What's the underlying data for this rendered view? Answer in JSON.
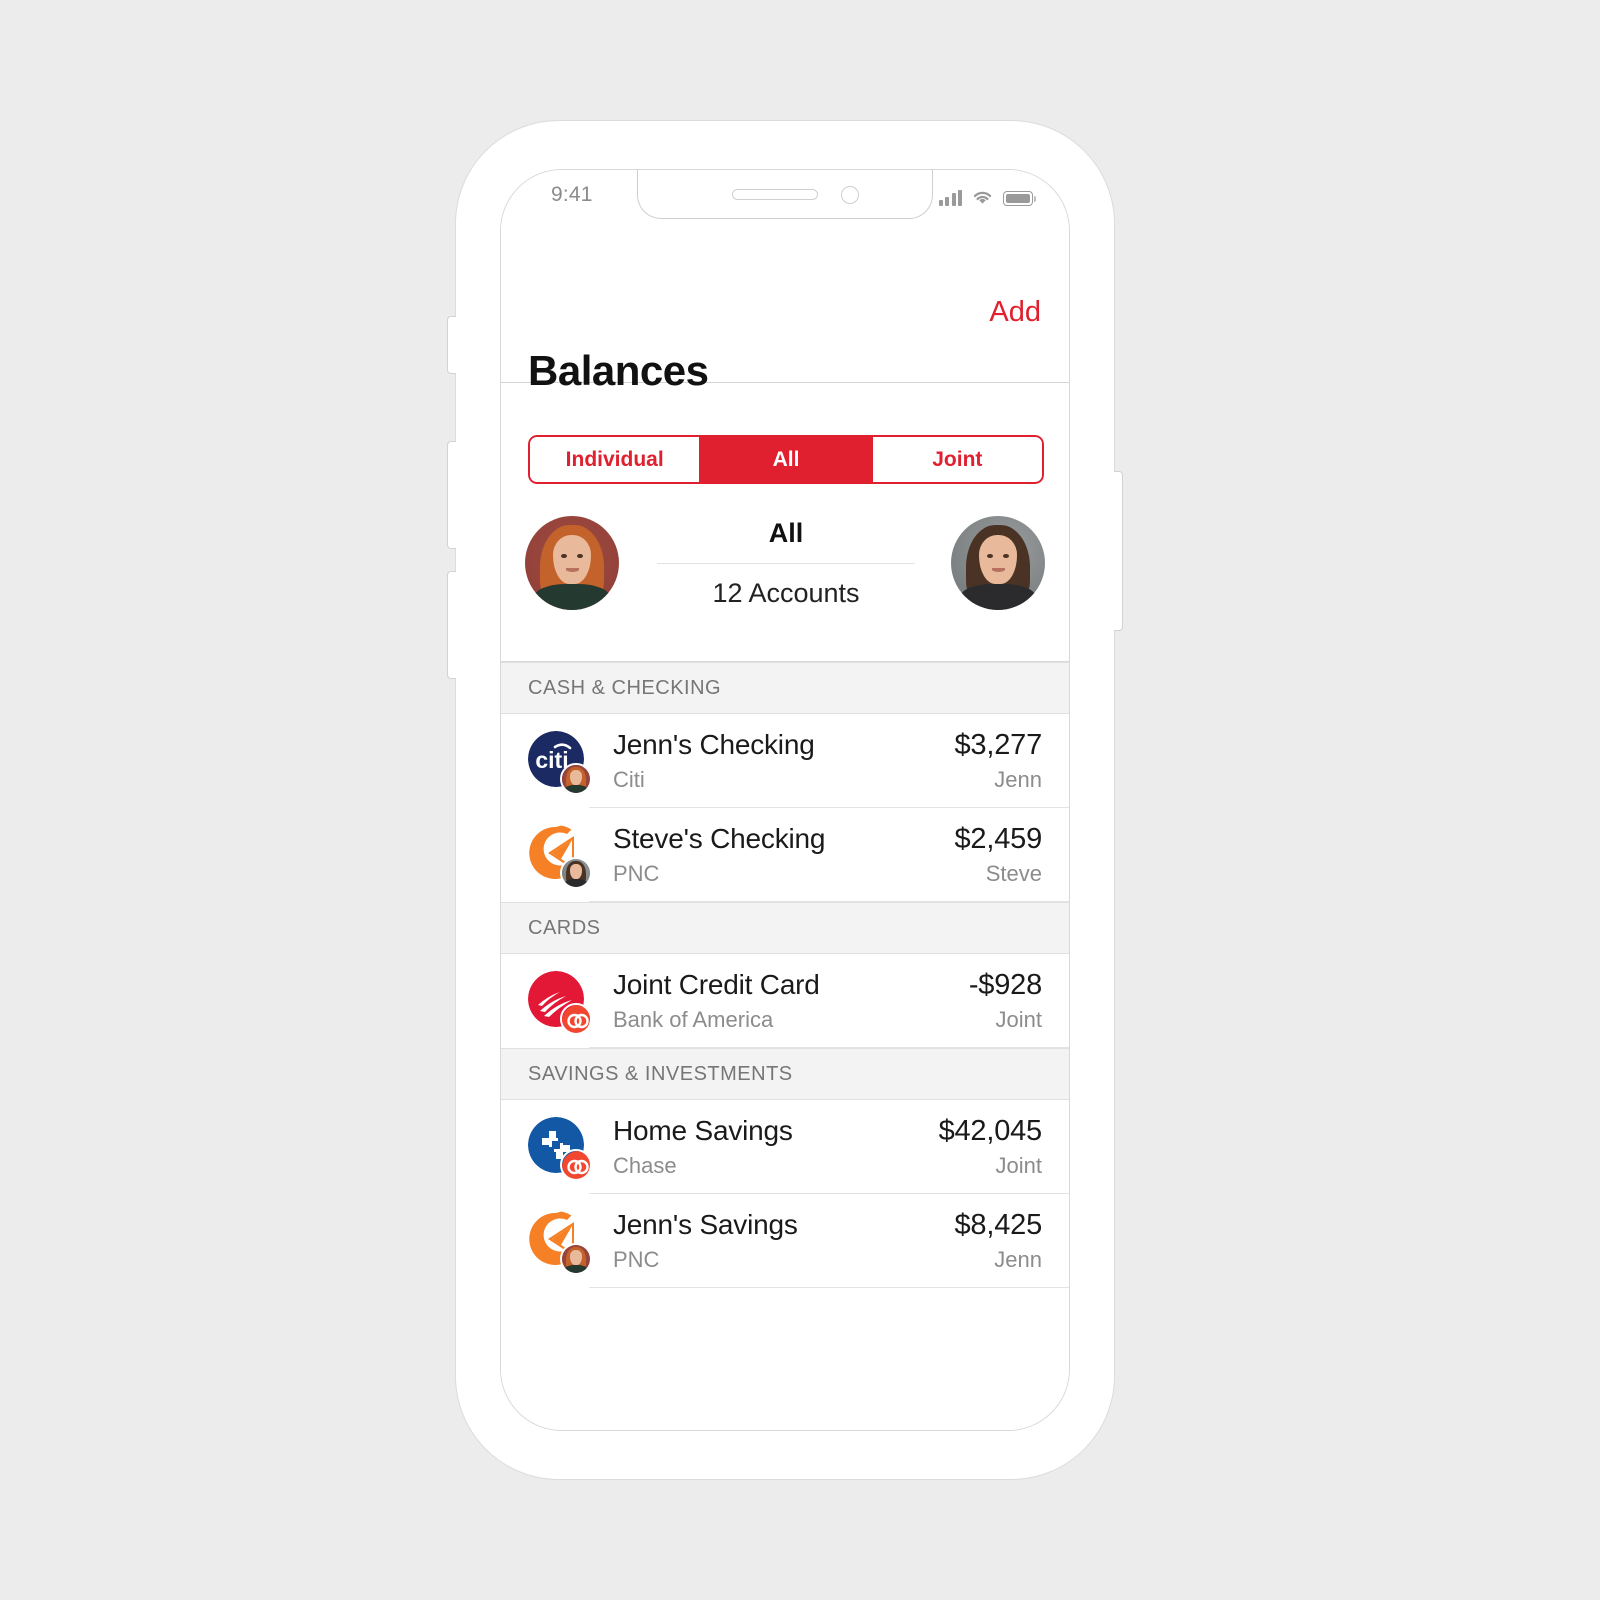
{
  "status_bar": {
    "time": "9:41",
    "signal_icon": "cellular-signal-icon",
    "wifi_icon": "wifi-icon",
    "battery_icon": "battery-icon"
  },
  "header": {
    "add_label": "Add",
    "title": "Balances",
    "accent_color": "#e0202f"
  },
  "segmented_control": {
    "options": [
      {
        "label": "Individual",
        "active": false
      },
      {
        "label": "All",
        "active": true
      },
      {
        "label": "Joint",
        "active": false
      }
    ]
  },
  "summary": {
    "left_avatar": "jenn-avatar",
    "right_avatar": "steve-avatar",
    "title": "All",
    "subtitle": "12 Accounts"
  },
  "sections": [
    {
      "title": "CASH & CHECKING",
      "rows": [
        {
          "logo": "citi-logo",
          "badge": "jenn-avatar-badge",
          "name": "Jenn's Checking",
          "bank": "Citi",
          "amount": "$3,277",
          "owner": "Jenn"
        },
        {
          "logo": "pnc-logo",
          "badge": "steve-avatar-badge",
          "name": "Steve's Checking",
          "bank": "PNC",
          "amount": "$2,459",
          "owner": "Steve"
        }
      ]
    },
    {
      "title": "CARDS",
      "rows": [
        {
          "logo": "bank-of-america-logo",
          "badge": "joint-rings-badge",
          "name": "Joint Credit Card",
          "bank": "Bank of America",
          "amount": "-$928",
          "owner": "Joint"
        }
      ]
    },
    {
      "title": "SAVINGS & INVESTMENTS",
      "rows": [
        {
          "logo": "chase-logo",
          "badge": "joint-rings-badge",
          "name": "Home Savings",
          "bank": "Chase",
          "amount": "$42,045",
          "owner": "Joint"
        },
        {
          "logo": "pnc-logo",
          "badge": "jenn-avatar-badge",
          "name": "Jenn's Savings",
          "bank": "PNC",
          "amount": "$8,425",
          "owner": "Jenn"
        }
      ]
    }
  ],
  "brand_colors": {
    "citi_navy": "#1b2a63",
    "pnc_orange": "#f58025",
    "bofa_red": "#e31837",
    "chase_blue": "#1358a5",
    "joint_badge": "#f1462f",
    "accent_red": "#e0202f"
  },
  "device": {
    "side_buttons": [
      "mute-switch",
      "volume-up-button",
      "volume-down-button",
      "power-button"
    ]
  }
}
